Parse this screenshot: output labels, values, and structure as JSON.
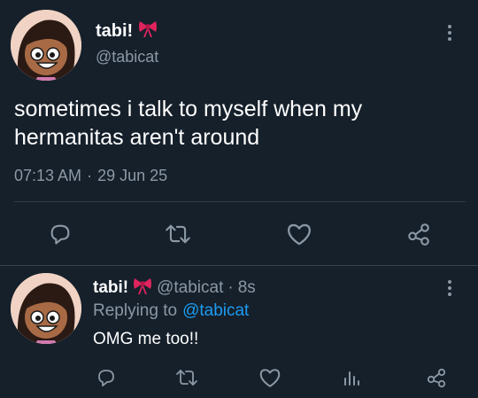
{
  "main_tweet": {
    "display_name": "tabi!",
    "name_emoji": "bow",
    "handle": "@tabicat",
    "text_line1": "sometimes i talk to myself when my",
    "text_line2": "hermanitas aren't around",
    "time": "07:13 AM",
    "separator": "·",
    "date": "29 Jun 25"
  },
  "reply": {
    "display_name": "tabi!",
    "name_emoji": "bow",
    "handle": "@tabicat",
    "separator": "·",
    "age": "8s",
    "replying_to_label": "Replying to",
    "replying_to_handle": "@tabicat",
    "text": "OMG me too!!"
  },
  "colors": {
    "background": "#15202b",
    "muted": "#8b98a5",
    "link": "#1d9bf0",
    "bow": "#e0245e"
  },
  "icons": {
    "main_actions": [
      "reply-icon",
      "retweet-icon",
      "like-icon",
      "share-icon"
    ],
    "reply_actions": [
      "reply-icon",
      "retweet-icon",
      "like-icon",
      "stats-icon",
      "share-icon"
    ]
  }
}
